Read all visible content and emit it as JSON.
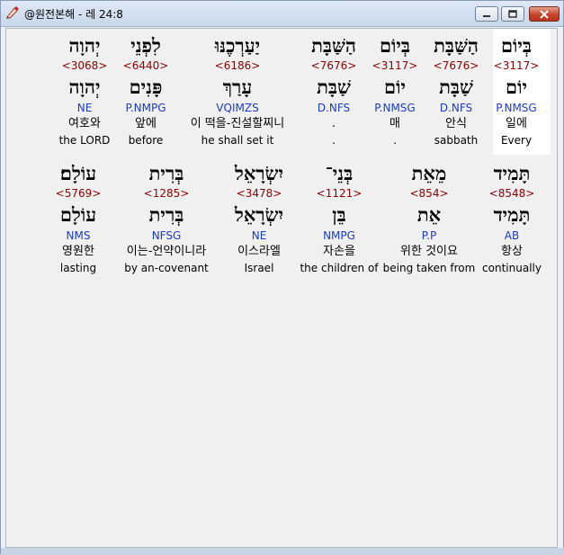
{
  "window": {
    "title": "@원전본해 - 레 24:8"
  },
  "rows": [
    {
      "words": [
        {
          "heb": "בְּיוֹם",
          "strong": "<3117>",
          "lemma": "יוֹם",
          "morph": "P.NMSG",
          "kor": "일에",
          "eng": "Every"
        },
        {
          "heb": "הַשַּׁבָּת",
          "strong": "<7676>",
          "lemma": "שַׁבָּת",
          "morph": "D.NFS",
          "kor": "안식",
          "eng": "sabbath"
        },
        {
          "heb": "בְּיוֹם",
          "strong": "<3117>",
          "lemma": "יוֹם",
          "morph": "P.NMSG",
          "kor": "매",
          "eng": "."
        },
        {
          "heb": "הַשַּׁבָּת",
          "strong": "<7676>",
          "lemma": "שַׁבָּת",
          "morph": "D.NFS",
          "kor": ".",
          "eng": "."
        },
        {
          "heb": "יַעַרְכֶנּוּ",
          "strong": "<6186>",
          "lemma": "עָרַךְ",
          "morph": "VQIMZS",
          "kor": "이 떡을-진설할찌니",
          "eng": "he shall set it"
        },
        {
          "heb": "לִפְנֵי",
          "strong": "<6440>",
          "lemma": "פָּנִים",
          "morph": "P.NMPG",
          "kor": "앞에",
          "eng": "before"
        },
        {
          "heb": "יְהוָה",
          "strong": "<3068>",
          "lemma": "יְהוָה",
          "morph": "NE",
          "kor": "여호와",
          "eng": "the LORD"
        }
      ]
    },
    {
      "words": [
        {
          "heb": "תָּמִיד",
          "strong": "<8548>",
          "lemma": "תָּמִיד",
          "morph": "AB",
          "kor": "항상",
          "eng": "continually"
        },
        {
          "heb": "מֵאֵת",
          "strong": "<854>",
          "lemma": "אֵת",
          "morph": "P.P",
          "kor": "위한 것이요",
          "eng": "being taken from"
        },
        {
          "heb": "בְּנֵי־",
          "strong": "<1121>",
          "lemma": "בֵּן",
          "morph": "NMPG",
          "kor": "자손을",
          "eng": "the children of"
        },
        {
          "heb": "יִשְׂרָאֵל",
          "strong": "<3478>",
          "lemma": "יִשְׂרָאֵל",
          "morph": "NE",
          "kor": "이스라엘",
          "eng": "Israel"
        },
        {
          "heb": "בְּרִית",
          "strong": "<1285>",
          "lemma": "בְּרִית",
          "morph": "NFSG",
          "kor": "이는-언약이니라",
          "eng": "by an-covenant"
        },
        {
          "heb": "עוֹלָם׃",
          "strong": "<5769>",
          "lemma": "עוֹלָם",
          "morph": "NMS",
          "kor": "영원한",
          "eng": "lasting"
        }
      ]
    }
  ],
  "colors": {
    "strong": "#8b0000",
    "morph": "#1a3cc8",
    "highlight": "#ffffff"
  },
  "icons": [
    "app-icon",
    "minimize-icon",
    "maximize-icon",
    "close-icon"
  ]
}
